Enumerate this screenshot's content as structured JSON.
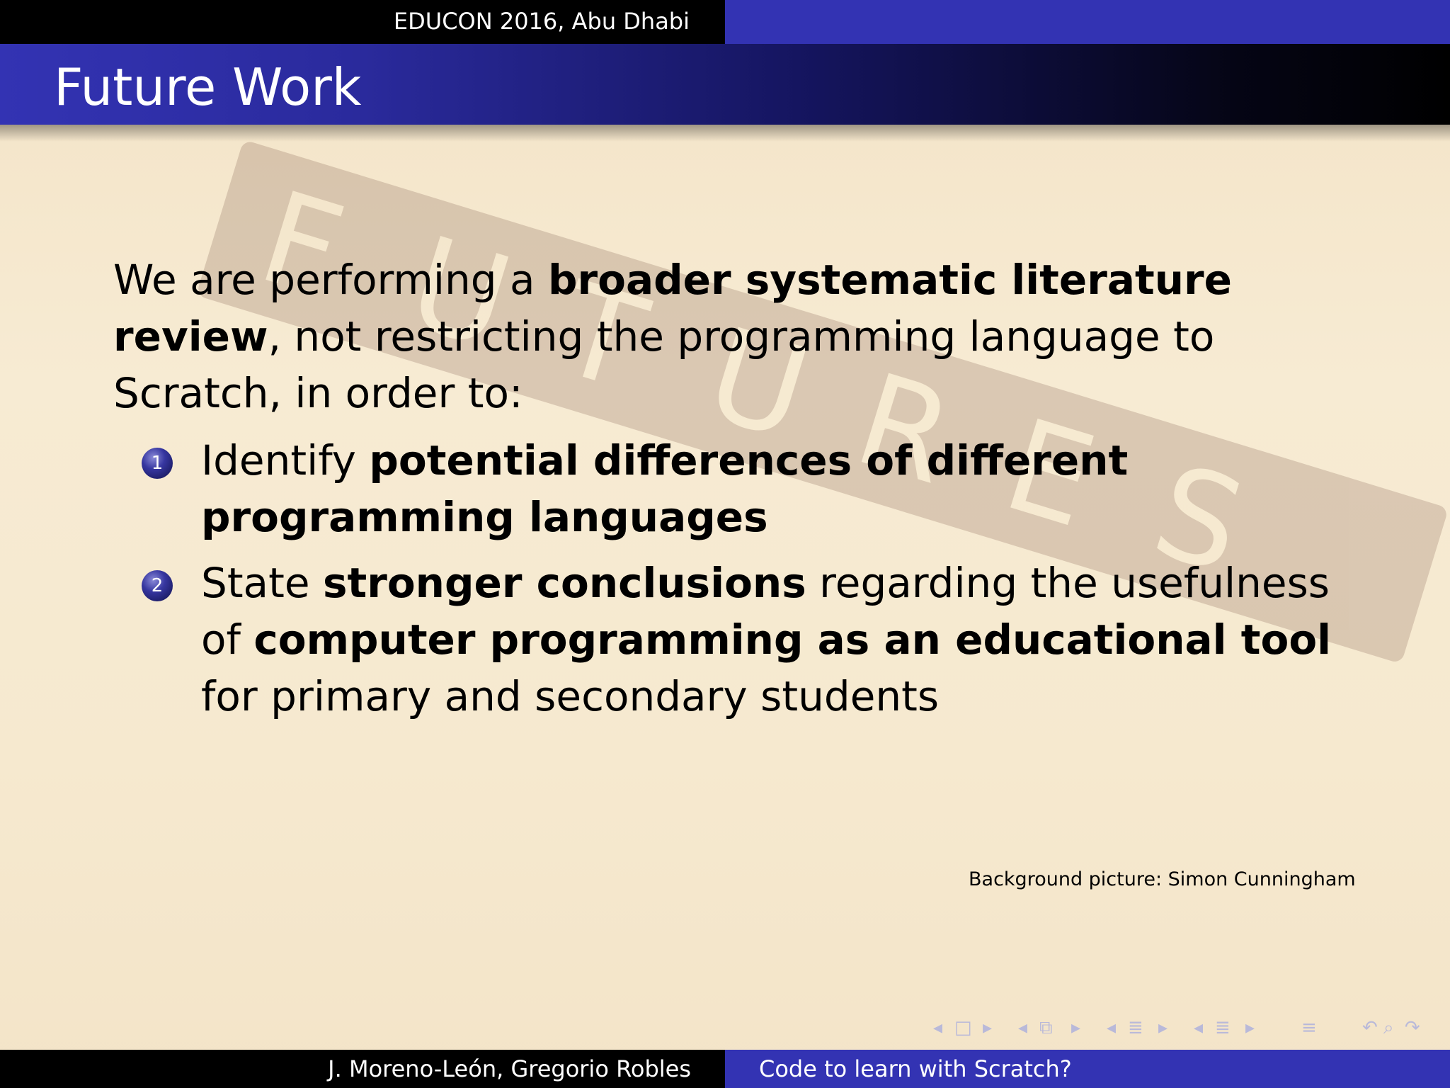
{
  "header": {
    "conference": "EDUCON 2016, Abu Dhabi"
  },
  "slide": {
    "title": "Future Work",
    "intro": {
      "t1": "We are performing a ",
      "b1": "broader systematic literature review",
      "t2": ", not restricting the programming language to Scratch, in order to:"
    },
    "items": [
      {
        "number": "1",
        "t1": "Identify ",
        "b1": "potential differences of different programming languages"
      },
      {
        "number": "2",
        "t1": "State ",
        "b1": "stronger conclusions",
        "t2": " regarding the usefulness of ",
        "b2": "computer programming as an educational tool",
        "t3": " for primary and secondary students"
      }
    ],
    "credit": "Background picture: Simon Cunningham"
  },
  "footer": {
    "authors": "J. Moreno-León, Gregorio Robles",
    "short_title": "Code to learn with Scratch?"
  },
  "navigation": {
    "icons": [
      "nav-prev-frame-icon",
      "nav-frame-icon",
      "nav-next-frame-icon",
      "nav-prev-subsection-icon",
      "nav-subsection-icon",
      "nav-next-subsection-icon",
      "nav-prev-section-icon",
      "nav-section-icon",
      "nav-next-section-icon",
      "nav-prev-doc-icon",
      "nav-doc-icon",
      "nav-next-doc-icon",
      "nav-toc-icon",
      "nav-back-icon",
      "nav-search-icon",
      "nav-forward-icon"
    ]
  },
  "colors": {
    "beamer_blue": "#3333b3",
    "background": "#f8ecd6"
  }
}
